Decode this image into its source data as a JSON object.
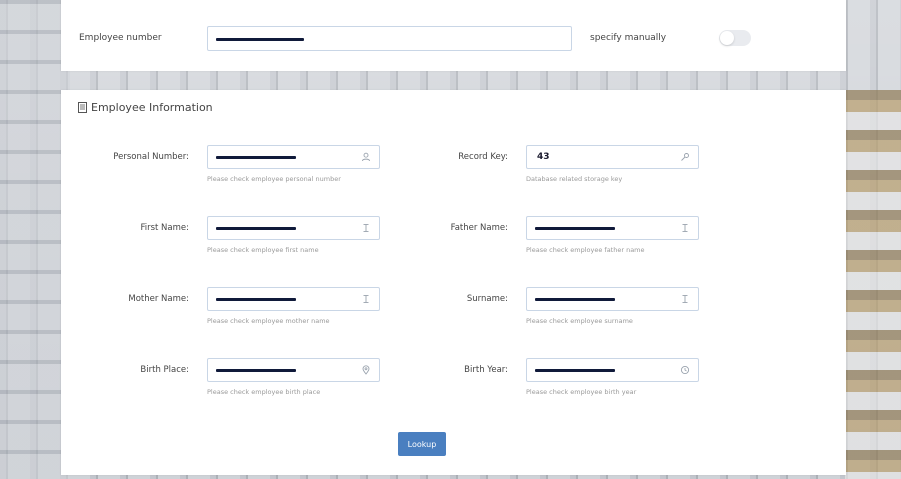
{
  "top": {
    "employee_number_label": "Employee number",
    "employee_number_value": "",
    "specify_manually_label": "specify manually",
    "specify_manually_on": false
  },
  "section": {
    "title": "Employee Information"
  },
  "fields": {
    "personal_number": {
      "label": "Personal Number:",
      "value": "",
      "help": "Please check employee personal number",
      "icon": "user-icon"
    },
    "record_key": {
      "label": "Record Key:",
      "value": "43",
      "help": "Database related storage key",
      "icon": "key-icon"
    },
    "first_name": {
      "label": "First Name:",
      "value": "",
      "help": "Please check employee first name",
      "icon": "text-cursor-icon"
    },
    "father_name": {
      "label": "Father Name:",
      "value": "",
      "help": "Please check employee father name",
      "icon": "text-cursor-icon"
    },
    "mother_name": {
      "label": "Mother Name:",
      "value": "",
      "help": "Please check employee mother name",
      "icon": "text-cursor-icon"
    },
    "surname": {
      "label": "Surname:",
      "value": "",
      "help": "Please check employee surname",
      "icon": "text-cursor-icon"
    },
    "birth_place": {
      "label": "Birth Place:",
      "value": "",
      "help": "Please check employee birth place",
      "icon": "map-pin-icon"
    },
    "birth_year": {
      "label": "Birth Year:",
      "value": "",
      "help": "Please check employee birth year",
      "icon": "clock-icon"
    }
  },
  "actions": {
    "lookup_label": "Lookup",
    "button_color": "#4a7fc0"
  }
}
